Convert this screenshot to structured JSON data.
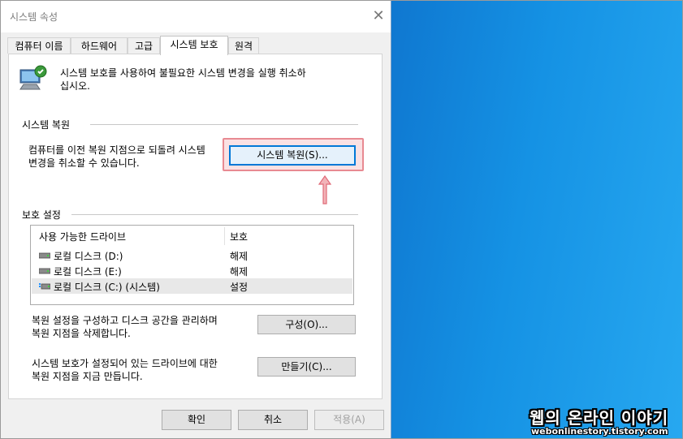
{
  "window": {
    "title": "시스템 속성",
    "close_glyph": "✕"
  },
  "tabs": [
    {
      "label": "컴퓨터 이름"
    },
    {
      "label": "하드웨어"
    },
    {
      "label": "고급"
    },
    {
      "label": "시스템 보호"
    },
    {
      "label": "원격"
    }
  ],
  "active_tab": "시스템 보호",
  "intro": {
    "line1": "시스템 보호를 사용하여 불필요한 시스템 변경을 실행 취소하",
    "line2": "십시오.",
    "icon": "computer-shield-icon"
  },
  "restore_section": {
    "title": "시스템 복원",
    "desc_line1": "컴퓨터를 이전 복원 지점으로 되돌려 시스템",
    "desc_line2": "변경을 취소할 수 있습니다.",
    "button_label": "시스템 복원(S)..."
  },
  "protection_section": {
    "title": "보호 설정",
    "columns": [
      "사용 가능한 드라이브",
      "보호"
    ],
    "drives": [
      {
        "name": "로컬 디스크 (D:)",
        "status": "해제",
        "icon": "drive-icon"
      },
      {
        "name": "로컬 디스크 (E:)",
        "status": "해제",
        "icon": "drive-icon"
      },
      {
        "name": "로컬 디스크 (C:) (시스템)",
        "status": "설정",
        "icon": "system-drive-icon"
      }
    ],
    "configure_desc_line1": "복원 설정을 구성하고 디스크 공간을 관리하며",
    "configure_desc_line2": "복원 지점을 삭제합니다.",
    "configure_button": "구성(O)...",
    "create_desc_line1": "시스템 보호가 설정되어 있는 드라이브에 대한",
    "create_desc_line2": "복원 지점을 지금 만듭니다.",
    "create_button": "만들기(C)..."
  },
  "footer": {
    "ok": "확인",
    "cancel": "취소",
    "apply": "적용(A)"
  },
  "watermark": {
    "line1": "웹의 온라인 이야기",
    "line2": "webonlinestory.tistory.com"
  },
  "colors": {
    "highlight": "#e88a92",
    "desktop": "#1592e4",
    "accent": "#0078d7"
  }
}
